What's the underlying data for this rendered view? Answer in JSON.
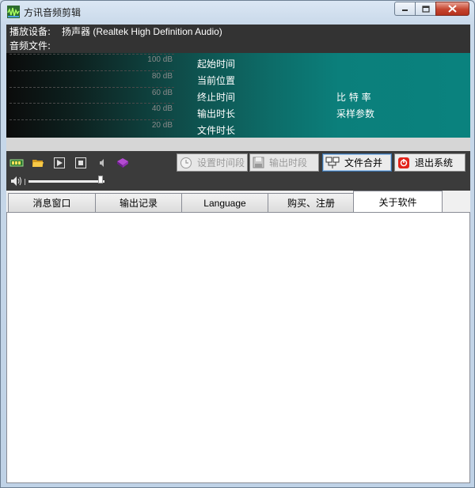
{
  "window": {
    "title": "方讯音频剪辑",
    "icon": "app-waveform-icon",
    "controls": {
      "minimize": "minimize-icon",
      "maximize": "maximize-icon",
      "close": "close-icon"
    }
  },
  "info": {
    "device_label": "播放设备:",
    "device_value": "扬声器 (Realtek High Definition Audio)",
    "file_label": "音频文件:",
    "file_value": ""
  },
  "meter": {
    "db_levels": [
      "100 dB",
      "80 dB",
      "60 dB",
      "40 dB",
      "20 dB"
    ],
    "labels_col1": [
      "起始时间",
      "当前位置",
      "终止时间",
      "输出时长",
      "文件时长"
    ],
    "labels_col2": [
      "比 特 率",
      "采样参数"
    ],
    "colors": {
      "left": "#0b0b0b",
      "right": "#0a827e"
    }
  },
  "toolbar": {
    "icons": [
      "record-icon",
      "open-folder-icon",
      "play-icon",
      "stop-icon",
      "volume-low-icon",
      "book-icon"
    ],
    "buttons": [
      {
        "label": "设置时间段",
        "icon": "clock-icon",
        "enabled": false
      },
      {
        "label": "输出时段",
        "icon": "save-disk-icon",
        "enabled": false
      },
      {
        "label": "文件合并",
        "icon": "merge-icon",
        "enabled": true
      },
      {
        "label": "退出系统",
        "icon": "exit-icon",
        "enabled": true
      }
    ],
    "volume": {
      "icon": "speaker-icon",
      "level": 0.95
    }
  },
  "tabs": {
    "items": [
      "消息窗口",
      "输出记录",
      "Language",
      "购买、注册",
      "关于软件"
    ],
    "active_index": 4
  }
}
